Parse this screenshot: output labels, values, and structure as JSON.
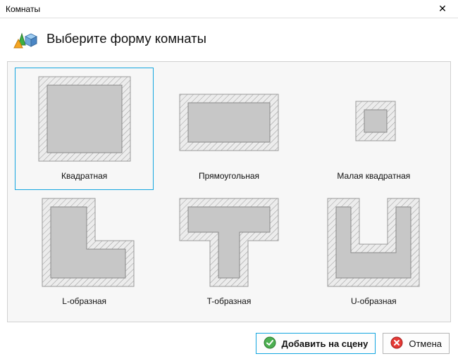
{
  "window": {
    "title": "Комнаты"
  },
  "header": {
    "title": "Выберите форму комнаты"
  },
  "shapes": [
    {
      "id": "square",
      "label": "Квадратная",
      "selected": true
    },
    {
      "id": "rect",
      "label": "Прямоугольная",
      "selected": false
    },
    {
      "id": "small-square",
      "label": "Малая квадратная",
      "selected": false
    },
    {
      "id": "l-shape",
      "label": "L-образная",
      "selected": false
    },
    {
      "id": "t-shape",
      "label": "T-образная",
      "selected": false
    },
    {
      "id": "u-shape",
      "label": "U-образная",
      "selected": false
    }
  ],
  "buttons": {
    "add": "Добавить на сцену",
    "cancel": "Отмена"
  }
}
